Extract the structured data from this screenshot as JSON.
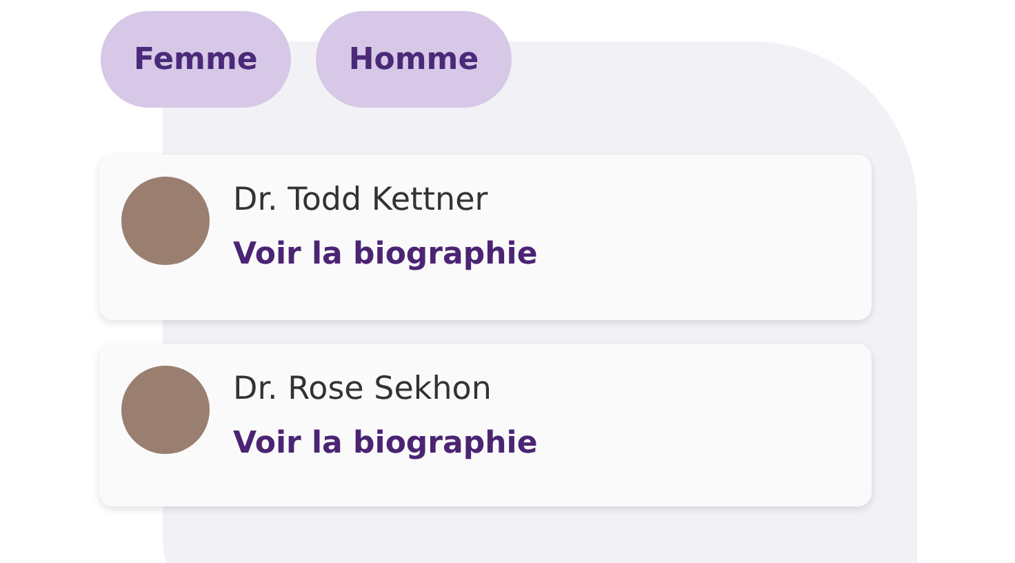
{
  "filters": [
    {
      "label": "Femme"
    },
    {
      "label": "Homme"
    }
  ],
  "doctors": [
    {
      "name": "Dr. Todd Kettner",
      "link": "Voir la biographie"
    },
    {
      "name": "Dr. Rose Sekhon",
      "link": "Voir la biographie"
    }
  ]
}
